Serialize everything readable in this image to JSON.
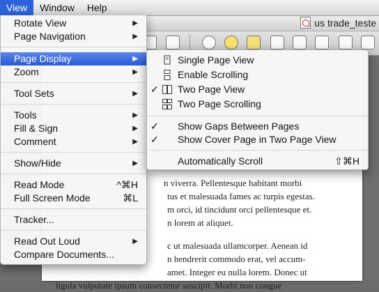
{
  "menubar": {
    "items": [
      {
        "label": "View",
        "active": true
      },
      {
        "label": "Window",
        "active": false
      },
      {
        "label": "Help",
        "active": false
      }
    ]
  },
  "window": {
    "title": "us trade_teste"
  },
  "view_menu": {
    "items": [
      {
        "label": "Rotate View",
        "arrow": true
      },
      {
        "label": "Page Navigation",
        "arrow": true
      },
      {
        "label": "Page Display",
        "arrow": true,
        "highlight": true
      },
      {
        "label": "Zoom",
        "arrow": true
      },
      {
        "label": "Tool Sets",
        "arrow": true
      },
      {
        "label": "Tools",
        "arrow": true
      },
      {
        "label": "Fill & Sign",
        "arrow": true
      },
      {
        "label": "Comment",
        "arrow": true
      },
      {
        "label": "Show/Hide",
        "arrow": true
      },
      {
        "label": "Read Mode",
        "shortcut": "^⌘H"
      },
      {
        "label": "Full Screen Mode",
        "shortcut": "⌘L"
      },
      {
        "label": "Tracker..."
      },
      {
        "label": "Read Out Loud",
        "arrow": true
      },
      {
        "label": "Compare Documents..."
      }
    ]
  },
  "page_display_menu": {
    "items": [
      {
        "label": "Single Page View",
        "icon": "single-page-icon",
        "checked": false
      },
      {
        "label": "Enable Scrolling",
        "icon": "scrolling-icon",
        "checked": false
      },
      {
        "label": "Two Page View",
        "icon": "two-page-icon",
        "checked": true
      },
      {
        "label": "Two Page Scrolling",
        "icon": "two-page-scrolling-icon",
        "checked": false
      },
      {
        "label": "Show Gaps Between Pages",
        "checked": true
      },
      {
        "label": "Show Cover Page in Two Page View",
        "checked": true
      },
      {
        "label": "Automatically Scroll",
        "shortcut": "⇧⌘H"
      }
    ],
    "check_mark": "✓"
  },
  "document": {
    "lines": [
      "n viverra. Pellentesque habitant morbi",
      "tus et malesuada fames ac turpis egestas.",
      "m orci, id tincidunt orci pellentesque et.",
      "n lorem at aliquet.",
      "",
      "c ut malesuada ullamcorper. Aenean id",
      "n hendrerit commodo erat, vel accum-",
      "amet. Integer eu nulla lorem. Donec ut",
      "ligula vulputate ipsum consectetur suscipit. Morbi non congue"
    ]
  }
}
